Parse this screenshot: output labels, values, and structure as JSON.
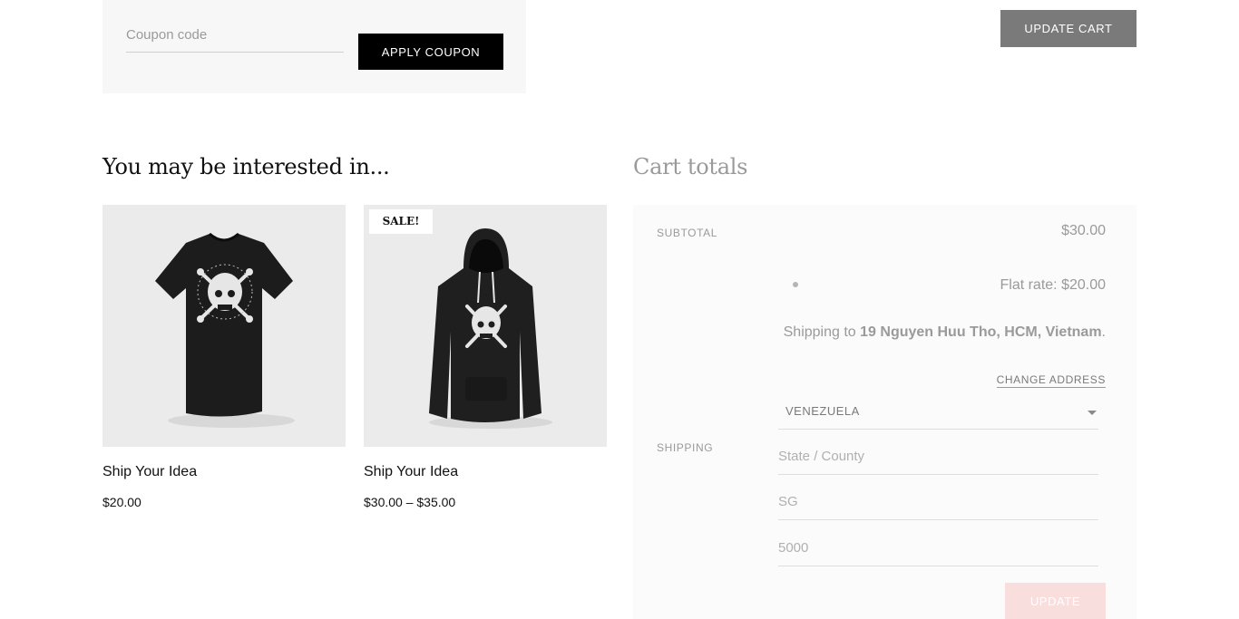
{
  "coupon": {
    "placeholder": "Coupon code",
    "apply_label": "APPLY COUPON"
  },
  "update_cart_label": "UPDATE CART",
  "related": {
    "heading": "You may be interested in...",
    "products": [
      {
        "title": "Ship Your Idea",
        "price": "$20.00",
        "image": "black-tshirt-skull",
        "sale": false
      },
      {
        "title": "Ship Your Idea",
        "price": "$30.00 – $35.00",
        "image": "black-hoodie-skull",
        "sale": true,
        "badge": "SALE!"
      }
    ]
  },
  "cart_totals": {
    "heading": "Cart totals",
    "subtotal_label": "SUBTOTAL",
    "subtotal_value": "$30.00",
    "shipping_label": "SHIPPING",
    "flat_rate": "Flat rate: $20.00",
    "shipping_to_prefix": "Shipping to ",
    "shipping_to_address": "19 Nguyen Huu Tho, HCM, Vietnam",
    "shipping_to_suffix": ".",
    "change_address": "CHANGE ADDRESS",
    "country": "VENEZUELA",
    "state_placeholder": "State / County",
    "city_value": "SG",
    "postcode_value": "5000",
    "update_label": "UPDATE"
  },
  "colors": {
    "button_dark": "#000000",
    "button_gray": "#7a7a7a",
    "update_disabled": "#f9dede",
    "panel_bg": "#f7f7f7"
  }
}
